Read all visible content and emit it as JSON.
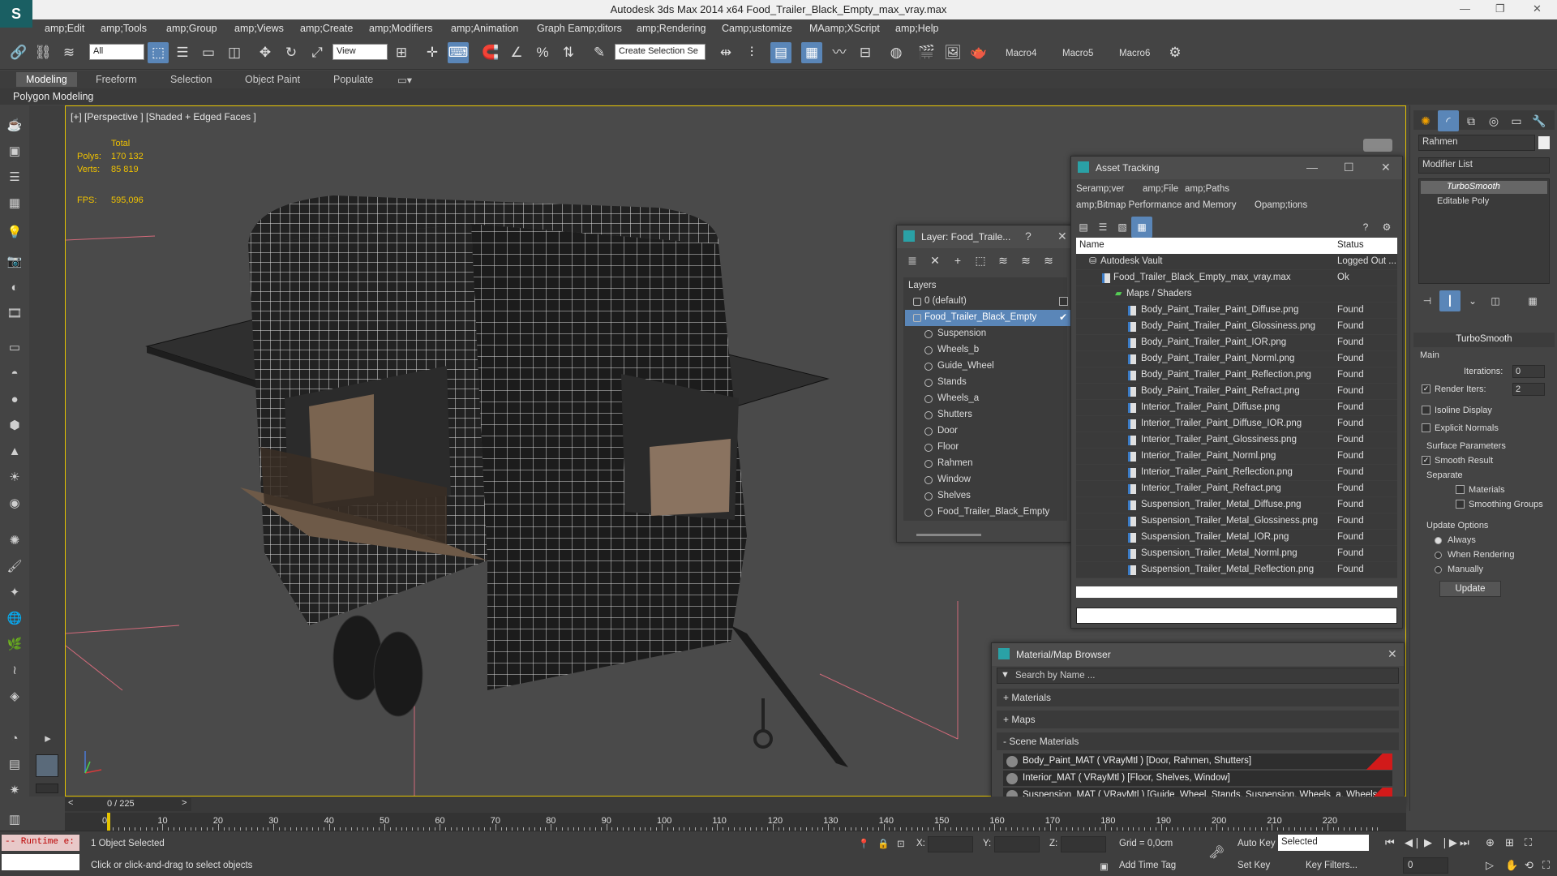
{
  "app": {
    "title": "Autodesk 3ds Max  2014 x64    Food_Trailer_Black_Empty_max_vray.max",
    "logo": "S",
    "window_controls": [
      "—",
      "❐",
      "✕"
    ]
  },
  "menu": [
    "amp;Edit",
    "amp;Tools",
    "amp;Group",
    "amp;Views",
    "amp;Create",
    "amp;Modifiers",
    "amp;Animation",
    "Graph Eamp;ditors",
    "amp;Rendering",
    "Camp;ustomize",
    "MAamp;XScript",
    "amp;Help"
  ],
  "toolbar": {
    "selection_filter": "All",
    "ref_coord": "View",
    "named_selection_placeholder": "Create Selection Se",
    "macros": [
      "Macro4",
      "Macro5",
      "Macro6"
    ]
  },
  "ribbon": {
    "tabs": [
      "Modeling",
      "Freeform",
      "Selection",
      "Object Paint",
      "Populate"
    ],
    "active": "Modeling",
    "subpanel": "Polygon Modeling"
  },
  "viewport": {
    "label": "[+] [Perspective ] [Shaded + Edged Faces ]",
    "stats": {
      "total_label": "Total",
      "polys_label": "Polys:",
      "polys": "170 132",
      "verts_label": "Verts:",
      "verts": "85 819",
      "fps_label": "FPS:",
      "fps": "595,096"
    }
  },
  "layer_window": {
    "title": "Layer: Food_Traile...",
    "help": "?",
    "close": "✕",
    "header": "Layers",
    "layers": [
      {
        "label": "0 (default)",
        "level": 0,
        "selected": false
      },
      {
        "label": "Food_Trailer_Black_Empty",
        "level": 0,
        "selected": true
      },
      {
        "label": "Suspension",
        "level": 1,
        "selected": false
      },
      {
        "label": "Wheels_b",
        "level": 1,
        "selected": false
      },
      {
        "label": "Guide_Wheel",
        "level": 1,
        "selected": false
      },
      {
        "label": "Stands",
        "level": 1,
        "selected": false
      },
      {
        "label": "Wheels_a",
        "level": 1,
        "selected": false
      },
      {
        "label": "Shutters",
        "level": 1,
        "selected": false
      },
      {
        "label": "Door",
        "level": 1,
        "selected": false
      },
      {
        "label": "Floor",
        "level": 1,
        "selected": false
      },
      {
        "label": "Rahmen",
        "level": 1,
        "selected": false
      },
      {
        "label": "Window",
        "level": 1,
        "selected": false
      },
      {
        "label": "Shelves",
        "level": 1,
        "selected": false
      },
      {
        "label": "Food_Trailer_Black_Empty",
        "level": 1,
        "selected": false
      }
    ]
  },
  "asset_window": {
    "title": "Asset Tracking",
    "controls": [
      "—",
      "☐",
      "✕"
    ],
    "menu": [
      "Seramp;ver",
      "amp;File",
      "amp;Paths",
      "amp;Bitmap Performance and Memory",
      "Opamp;tions"
    ],
    "col_name": "Name",
    "col_status": "Status",
    "rows": [
      {
        "name": "Autodesk Vault",
        "status": "Logged Out ...",
        "level": 0
      },
      {
        "name": "Food_Trailer_Black_Empty_max_vray.max",
        "status": "Ok",
        "level": 1
      },
      {
        "name": "Maps / Shaders",
        "status": "",
        "level": 2
      },
      {
        "name": "Body_Paint_Trailer_Paint_Diffuse.png",
        "status": "Found",
        "level": 3
      },
      {
        "name": "Body_Paint_Trailer_Paint_Glossiness.png",
        "status": "Found",
        "level": 3
      },
      {
        "name": "Body_Paint_Trailer_Paint_IOR.png",
        "status": "Found",
        "level": 3
      },
      {
        "name": "Body_Paint_Trailer_Paint_Norml.png",
        "status": "Found",
        "level": 3
      },
      {
        "name": "Body_Paint_Trailer_Paint_Reflection.png",
        "status": "Found",
        "level": 3
      },
      {
        "name": "Body_Paint_Trailer_Paint_Refract.png",
        "status": "Found",
        "level": 3
      },
      {
        "name": "Interior_Trailer_Paint_Diffuse.png",
        "status": "Found",
        "level": 3
      },
      {
        "name": "Interior_Trailer_Paint_Diffuse_IOR.png",
        "status": "Found",
        "level": 3
      },
      {
        "name": "Interior_Trailer_Paint_Glossiness.png",
        "status": "Found",
        "level": 3
      },
      {
        "name": "Interior_Trailer_Paint_Norml.png",
        "status": "Found",
        "level": 3
      },
      {
        "name": "Interior_Trailer_Paint_Reflection.png",
        "status": "Found",
        "level": 3
      },
      {
        "name": "Interior_Trailer_Paint_Refract.png",
        "status": "Found",
        "level": 3
      },
      {
        "name": "Suspension_Trailer_Metal_Diffuse.png",
        "status": "Found",
        "level": 3
      },
      {
        "name": "Suspension_Trailer_Metal_Glossiness.png",
        "status": "Found",
        "level": 3
      },
      {
        "name": "Suspension_Trailer_Metal_IOR.png",
        "status": "Found",
        "level": 3
      },
      {
        "name": "Suspension_Trailer_Metal_Norml.png",
        "status": "Found",
        "level": 3
      },
      {
        "name": "Suspension_Trailer_Metal_Reflection.png",
        "status": "Found",
        "level": 3
      }
    ]
  },
  "material_browser": {
    "title": "Material/Map Browser",
    "search_placeholder": "Search by Name ...",
    "sections": [
      "+ Materials",
      "+ Maps",
      "- Scene Materials"
    ],
    "materials": [
      "Body_Paint_MAT  ( VRayMtl )  [Door, Rahmen, Shutters]",
      "Interior_MAT  ( VRayMtl )  [Floor, Shelves, Window]",
      "Suspension_MAT  ( VRayMtl )  [Guide_Wheel, Stands, Suspension, Wheels_a, Wheels_b]"
    ],
    "flag_color": "#d21a1a"
  },
  "command_panel": {
    "object_name": "Rahmen",
    "modifier_list": "Modifier List",
    "stack": [
      "TurboSmooth",
      "Editable Poly"
    ],
    "rollout_title": "TurboSmooth",
    "main_label": "Main",
    "iterations_label": "Iterations:",
    "iterations": "0",
    "render_iters_label": "Render Iters:",
    "render_iters": "2",
    "render_iters_checked": true,
    "isoline_label": "Isoline Display",
    "explicit_normals_label": "Explicit Normals",
    "surface_params_label": "Surface Parameters",
    "smooth_result_label": "Smooth Result",
    "separate_label": "Separate",
    "materials_label": "Materials",
    "smoothing_groups_label": "Smoothing Groups",
    "update_options_label": "Update Options",
    "always_label": "Always",
    "when_rendering_label": "When Rendering",
    "manually_label": "Manually",
    "update_button": "Update"
  },
  "timeline": {
    "frame_counter": "0 / 225",
    "ticks": [
      "0",
      "10",
      "20",
      "30",
      "40",
      "50",
      "60",
      "70",
      "80",
      "90",
      "100",
      "110",
      "120",
      "130",
      "140",
      "150",
      "160",
      "170",
      "180",
      "190",
      "200",
      "210",
      "220"
    ]
  },
  "status": {
    "runtime": "-- Runtime e:",
    "selected": "1 Object Selected",
    "prompt": "Click or click-and-drag to select objects",
    "x_label": "X:",
    "y_label": "Y:",
    "z_label": "Z:",
    "grid": "Grid = 0,0cm",
    "add_time_tag": "Add Time Tag",
    "auto_key": "Auto Key",
    "set_key": "Set Key",
    "key_mode": "Selected",
    "key_filters": "Key Filters...",
    "frame": "0"
  },
  "icons": {
    "viewport_accent": "#e4c300",
    "selection_blue": "#5a86b8"
  }
}
